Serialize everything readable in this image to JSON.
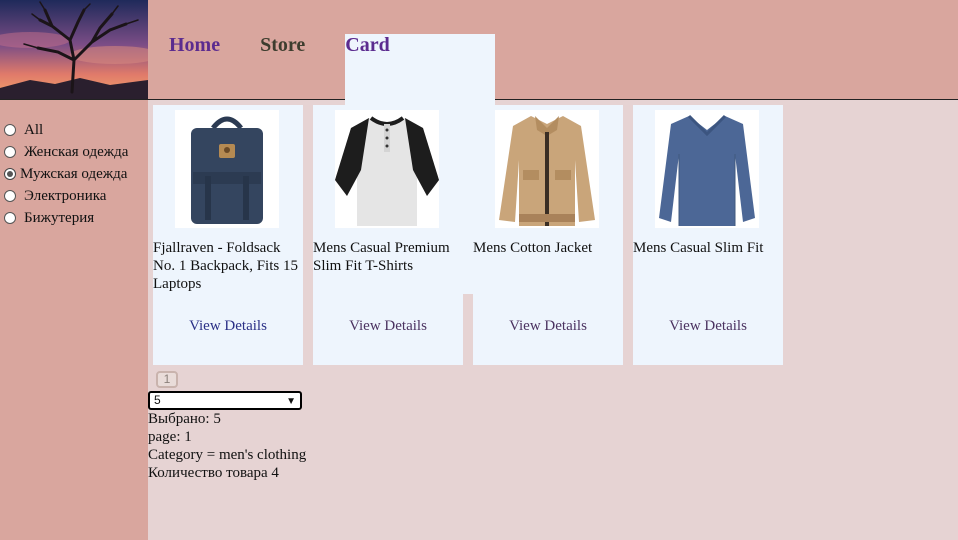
{
  "nav": {
    "home": "Home",
    "store": "Store",
    "card": "Card"
  },
  "filters": [
    {
      "label": "All",
      "checked": false
    },
    {
      "label": "Женская одежда",
      "checked": false
    },
    {
      "label": "Мужская одежда",
      "checked": true
    },
    {
      "label": "Электроника",
      "checked": false
    },
    {
      "label": "Бижутерия",
      "checked": false
    }
  ],
  "products": [
    {
      "title": "Fjallraven - Foldsack No. 1 Backpack, Fits 15 Laptops",
      "details": "View Details",
      "image": "backpack-image"
    },
    {
      "title": "Mens Casual Premium Slim Fit T-Shirts",
      "details": "View Details",
      "image": "tshirt-image"
    },
    {
      "title": "Mens Cotton Jacket",
      "details": "View Details",
      "image": "jacket-image"
    },
    {
      "title": "Mens Casual Slim Fit",
      "details": "View Details",
      "image": "longsleeve-image"
    }
  ],
  "pagination": {
    "page_button": "1"
  },
  "page_size_select": {
    "value": "5"
  },
  "info": {
    "selected": "Выбрано: 5",
    "page": "page: 1",
    "category": "Category = men's clothing",
    "count": "Количество товара 4"
  },
  "colors": {
    "header_bg": "#d9a69e",
    "sidebar_bg": "#d9a69e",
    "page_bg": "#e6d3d3",
    "card_bg": "#eef5fd",
    "nav_link": "#5b2b8f"
  }
}
